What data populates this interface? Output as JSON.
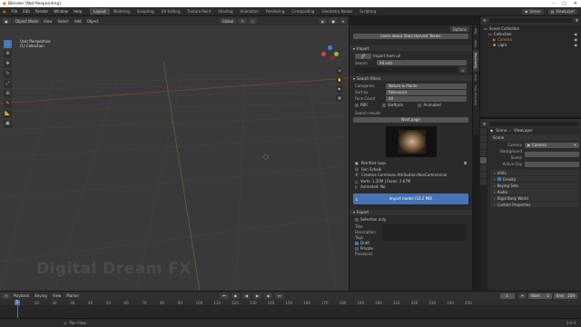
{
  "window": {
    "title": "Blender [Not Responding]",
    "min": "–",
    "max": "□",
    "close": "✕"
  },
  "menu": [
    "File",
    "Edit",
    "Render",
    "Window",
    "Help"
  ],
  "workspaces": [
    "Layout",
    "Modeling",
    "Sculpting",
    "UV Editing",
    "Texture Paint",
    "Shading",
    "Animation",
    "Rendering",
    "Compositing",
    "Geometry Nodes",
    "Scripting"
  ],
  "scene": {
    "label": "Scene",
    "viewlayer": "ViewLayer"
  },
  "viewport": {
    "mode": "Object Mode",
    "menus": [
      "View",
      "Select",
      "Add",
      "Object"
    ],
    "transform": "Global",
    "info_line1": "User Perspective",
    "info_line2": "(1) Collection",
    "watermark": "Digital Dream FX"
  },
  "sidebar": {
    "options": "Options",
    "learn_btn": "Learn about Stats Harvest Teams",
    "import_header": "Import",
    "import_from_url": "Import from url",
    "search_label": "Search",
    "search_value": "All sets",
    "search_filters": "Search filters",
    "categories_label": "Categories",
    "categories_value": "Nature & Plants",
    "sort_label": "Sort by",
    "sort_value": "Relevance",
    "face_label": "Face Count",
    "face_value": "All",
    "pbr": "PBR",
    "staffpick": "Staffpick",
    "animated": "Animated",
    "results_label": "Search results",
    "next_page": "Next page",
    "model_name": "Petrified Logs",
    "author": "Ron Schalk",
    "license": "Creative Commons Attribution-NonCommercial",
    "verts": "Verts: 1.35M | Faces: 2.67M",
    "animated_info": "Animated: No",
    "import_btn": "Import model (10.2 MB)",
    "export_header": "Export",
    "selection_only": "Selection only",
    "title_label": "Title",
    "desc_label": "Description",
    "tags_label": "Tags",
    "draft": "Draft",
    "private": "Private",
    "password": "Password"
  },
  "vtabs": [
    "Tool",
    "View",
    "Sketchfab",
    "Edit",
    "Shortcut VUr"
  ],
  "outliner": {
    "root": "Scene Collection",
    "items": [
      {
        "name": "Collection",
        "color": "#d0d0d0"
      },
      {
        "name": "Camera",
        "color": "#e07c3c"
      },
      {
        "name": "Light",
        "color": "#e0c060"
      }
    ]
  },
  "properties": {
    "crumb_scene": "Scene",
    "crumb_layer": "ViewLayer",
    "section": "Scene",
    "camera_label": "Camera",
    "camera_value": "Camera",
    "bg_label": "Background Scene",
    "clip_label": "Active Clip",
    "panels": [
      "Units",
      "Gravity",
      "Keying Sets",
      "Audio",
      "Rigid Body World",
      "Custom Properties"
    ]
  },
  "timeline": {
    "menus": [
      "Playback",
      "Keying",
      "View",
      "Marker"
    ],
    "current_frame": "1",
    "start_label": "Start",
    "start_value": "1",
    "end_label": "End",
    "end_value": "250",
    "ticks": [
      "1",
      "10",
      "20",
      "30",
      "40",
      "50",
      "60",
      "70",
      "80",
      "90",
      "100",
      "110",
      "120",
      "130",
      "140",
      "150",
      "160",
      "170",
      "180",
      "190",
      "200",
      "210",
      "220",
      "230",
      "240",
      "250"
    ]
  },
  "status": {
    "left": "Pan View",
    "right": "3.0.0"
  },
  "colors": {
    "accent": "#4772b3",
    "x_axis": "#e04040",
    "y_axis": "#80c040",
    "z_axis": "#4080e0"
  }
}
